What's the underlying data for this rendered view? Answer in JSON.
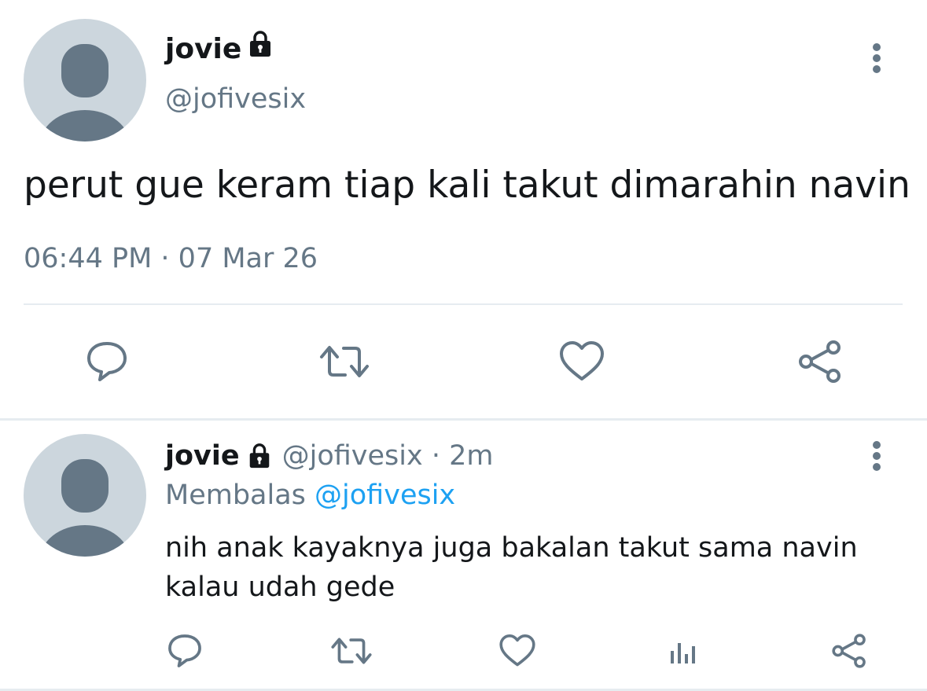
{
  "main_tweet": {
    "display_name": "jovie",
    "handle": "@jofivesix",
    "text": "perut gue keram tiap kali takut dimarahin navin",
    "timestamp": "06:44 PM · 07 Mar 26",
    "icons": {
      "lock": "lock-icon",
      "more": "more-vertical-icon",
      "reply": "reply-bubble-icon",
      "retweet": "retweet-icon",
      "like": "heart-icon",
      "share": "share-icon"
    }
  },
  "reply_tweet": {
    "display_name": "jovie",
    "meta": "@jofivesix · 2m",
    "replying_to_label": "Membalas",
    "replying_to_handle": "@jofivesix",
    "text": "nih anak kayaknya juga bakalan takut sama navin kalau udah gede",
    "icons": {
      "lock": "lock-icon",
      "more": "more-vertical-icon",
      "reply": "reply-bubble-icon",
      "retweet": "retweet-icon",
      "like": "heart-icon",
      "analytics": "analytics-icon",
      "share": "share-icon"
    }
  },
  "colors": {
    "text_primary": "#14171a",
    "text_secondary": "#657786",
    "link": "#1da1f2",
    "divider": "#e6ecf0",
    "avatar_bg": "#ccd6dd",
    "avatar_fg": "#657786"
  }
}
